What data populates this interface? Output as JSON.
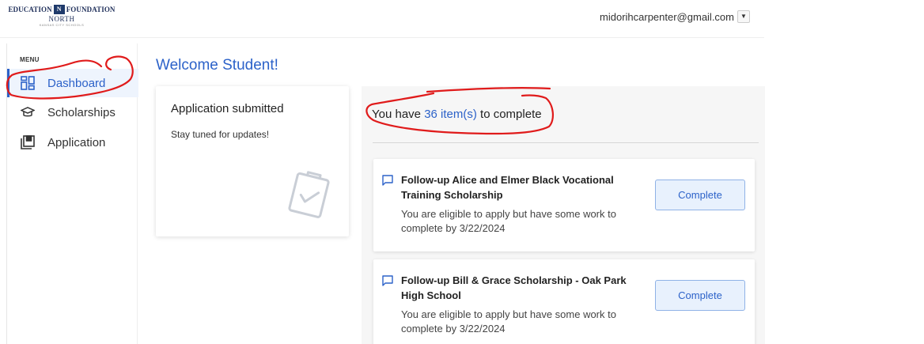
{
  "header": {
    "logo": {
      "top_left": "EDUCATION",
      "mark": "N",
      "top_right": "FOUNDATION",
      "middle": "NORTH",
      "bottom": "KANSAS CITY SCHOOLS"
    },
    "account_email": "midorihcarpenter@gmail.com",
    "account_dropdown_icon": "caret-down-icon"
  },
  "sidebar": {
    "menu_label": "MENU",
    "items": [
      {
        "label": "Dashboard",
        "icon": "dashboard-icon",
        "active": true
      },
      {
        "label": "Scholarships",
        "icon": "graduation-cap-icon",
        "active": false
      },
      {
        "label": "Application",
        "icon": "application-icon",
        "active": false
      }
    ]
  },
  "main": {
    "welcome": "Welcome Student!",
    "status_card": {
      "title": "Application submitted",
      "subtitle": "Stay tuned for updates!",
      "icon": "clipboard-check-icon"
    },
    "tasks": {
      "heading_prefix": "You have ",
      "heading_count": "36 item(s)",
      "heading_suffix": " to complete",
      "items": [
        {
          "title": "Follow-up Alice and Elmer Black Vocational Training Scholarship",
          "description": "You are eligible to apply but have some work to complete by 3/22/2024",
          "button": "Complete",
          "icon": "comment-icon"
        },
        {
          "title": "Follow-up Bill & Grace Scholarship - Oak Park High School",
          "description": "You are eligible to apply but have some work to complete by 3/22/2024",
          "button": "Complete",
          "icon": "comment-icon"
        }
      ]
    }
  },
  "colors": {
    "accent": "#2c62c9",
    "active_bg": "#eef4fd",
    "annotation": "#e01b1b"
  }
}
